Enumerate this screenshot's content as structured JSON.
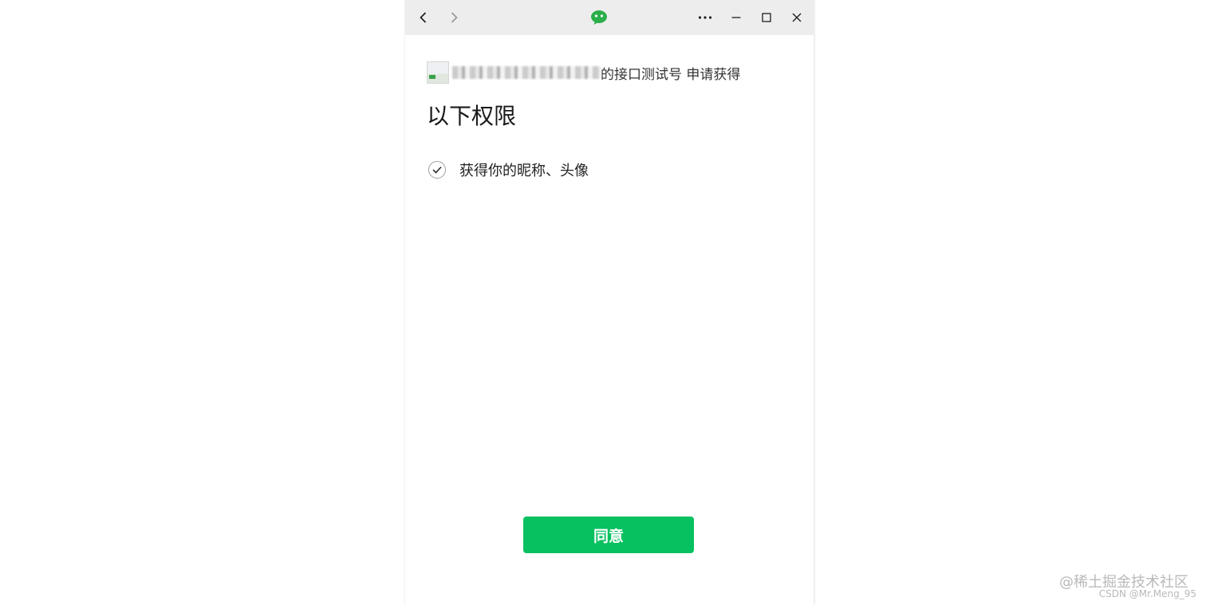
{
  "titlebar": {
    "icons": [
      "back-arrow-icon",
      "forward-arrow-icon",
      "wechat-logo-icon",
      "more-icon",
      "minimize-icon",
      "maximize-icon",
      "close-icon"
    ],
    "accent_color": "#07c160"
  },
  "auth": {
    "app_name_suffix": "的接口测试号 申请获得",
    "title": "以下权限",
    "permissions": [
      {
        "label": "获得你的昵称、头像",
        "icon": "check-circle-icon"
      }
    ],
    "agree_label": "同意",
    "agree_color": "#07c160"
  },
  "watermark": {
    "line1": "@稀土掘金技术社区",
    "line2": "CSDN @Mr.Meng_95"
  }
}
